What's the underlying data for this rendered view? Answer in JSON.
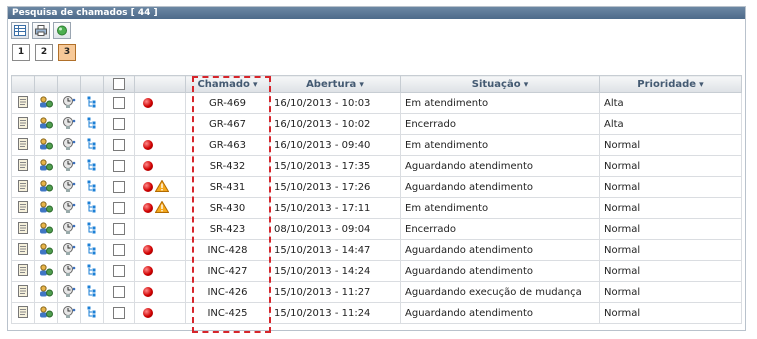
{
  "panel_title": "Pesquisa de chamados [ 44 ]",
  "toolbar_icons": [
    "table-view-icon",
    "print-icon",
    "refresh-icon"
  ],
  "pages": [
    "1",
    "2",
    "3"
  ],
  "active_page": "3",
  "columns": {
    "chamado": "Chamado",
    "abertura": "Abertura",
    "situacao": "Situação",
    "prioridade": "Prioridade"
  },
  "rows": [
    {
      "chamado": "GR-469",
      "abertura": "16/10/2013 - 10:03",
      "situacao": "Em atendimento",
      "prioridade": "Alta",
      "alert": true,
      "warning": false
    },
    {
      "chamado": "GR-467",
      "abertura": "16/10/2013 - 10:02",
      "situacao": "Encerrado",
      "prioridade": "Alta",
      "alert": false,
      "warning": false
    },
    {
      "chamado": "GR-463",
      "abertura": "16/10/2013 - 09:40",
      "situacao": "Em atendimento",
      "prioridade": "Normal",
      "alert": true,
      "warning": false
    },
    {
      "chamado": "SR-432",
      "abertura": "15/10/2013 - 17:35",
      "situacao": "Aguardando atendimento",
      "prioridade": "Normal",
      "alert": true,
      "warning": false
    },
    {
      "chamado": "SR-431",
      "abertura": "15/10/2013 - 17:26",
      "situacao": "Aguardando atendimento",
      "prioridade": "Normal",
      "alert": true,
      "warning": true
    },
    {
      "chamado": "SR-430",
      "abertura": "15/10/2013 - 17:11",
      "situacao": "Em atendimento",
      "prioridade": "Normal",
      "alert": true,
      "warning": true
    },
    {
      "chamado": "SR-423",
      "abertura": "08/10/2013 - 09:04",
      "situacao": "Encerrado",
      "prioridade": "Normal",
      "alert": false,
      "warning": false
    },
    {
      "chamado": "INC-428",
      "abertura": "15/10/2013 - 14:47",
      "situacao": "Aguardando atendimento",
      "prioridade": "Normal",
      "alert": true,
      "warning": false
    },
    {
      "chamado": "INC-427",
      "abertura": "15/10/2013 - 14:24",
      "situacao": "Aguardando atendimento",
      "prioridade": "Normal",
      "alert": true,
      "warning": false
    },
    {
      "chamado": "INC-426",
      "abertura": "15/10/2013 - 11:27",
      "situacao": "Aguardando execução de mudança",
      "prioridade": "Normal",
      "alert": true,
      "warning": false
    },
    {
      "chamado": "INC-425",
      "abertura": "15/10/2013 - 11:24",
      "situacao": "Aguardando atendimento",
      "prioridade": "Normal",
      "alert": true,
      "warning": false
    }
  ],
  "highlight_color": "#d6252b"
}
